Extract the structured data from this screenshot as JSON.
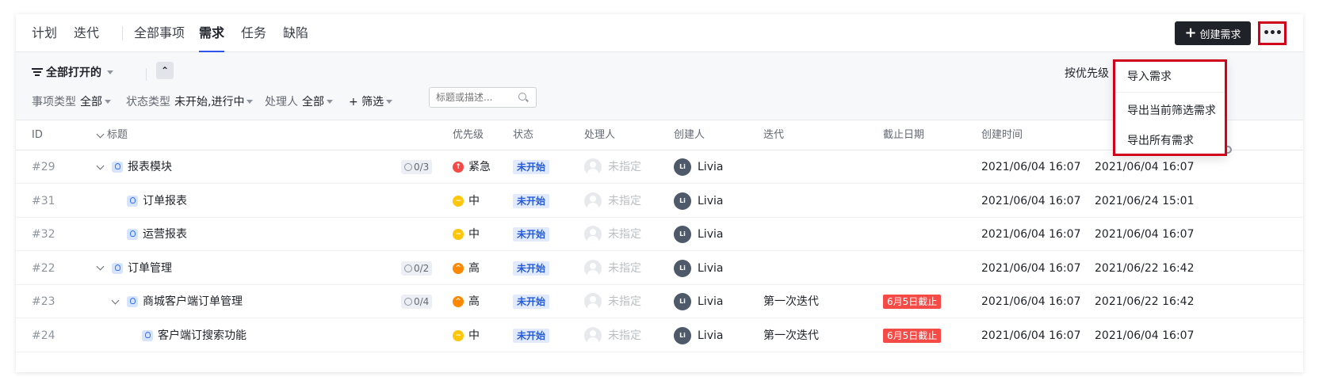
{
  "nav": {
    "items": [
      {
        "label": "计划"
      },
      {
        "label": "迭代"
      },
      {
        "label": "全部事项"
      },
      {
        "label": "需求"
      },
      {
        "label": "任务"
      },
      {
        "label": "缺陷"
      }
    ],
    "active": "需求",
    "create_button": "创建需求"
  },
  "filters": {
    "view": "全部打开的",
    "sort_label": "按优先级",
    "type": {
      "label": "事项类型",
      "value": "全部"
    },
    "status": {
      "label": "状态类型",
      "value": "未开始,进行中"
    },
    "assignee": {
      "label": "处理人",
      "value": "全部"
    },
    "more": "+ 筛选",
    "search_placeholder": "标题或描述..."
  },
  "table": {
    "headers": {
      "id": "ID",
      "title": "标题",
      "priority": "优先级",
      "status": "状态",
      "assignee": "处理人",
      "creator": "创建人",
      "iteration": "迭代",
      "due": "截止日期",
      "created": "创建时间"
    },
    "rows": [
      {
        "id": "#29",
        "level": 0,
        "expand": true,
        "title": "报表模块",
        "children_count": "0/3",
        "priority": "紧急",
        "priority_color": "#f54a45",
        "status": "未开始",
        "assignee": "未指定",
        "creator": "Livia",
        "iteration": "",
        "due": "",
        "created": "2021/06/04 16:07",
        "updated": "2021/06/04 16:07"
      },
      {
        "id": "#31",
        "level": 1,
        "expand": false,
        "title": "订单报表",
        "children_count": "",
        "priority": "中",
        "priority_color": "#ffc60a",
        "status": "未开始",
        "assignee": "未指定",
        "creator": "Livia",
        "iteration": "",
        "due": "",
        "created": "2021/06/04 16:07",
        "updated": "2021/06/24 15:01"
      },
      {
        "id": "#32",
        "level": 1,
        "expand": false,
        "title": "运营报表",
        "children_count": "",
        "priority": "中",
        "priority_color": "#ffc60a",
        "status": "未开始",
        "assignee": "未指定",
        "creator": "Livia",
        "iteration": "",
        "due": "",
        "created": "2021/06/04 16:07",
        "updated": "2021/06/04 16:07"
      },
      {
        "id": "#22",
        "level": 0,
        "expand": true,
        "title": "订单管理",
        "children_count": "0/2",
        "priority": "高",
        "priority_color": "#ff8800",
        "status": "未开始",
        "assignee": "未指定",
        "creator": "Livia",
        "iteration": "",
        "due": "",
        "created": "2021/06/04 16:07",
        "updated": "2021/06/22 16:42"
      },
      {
        "id": "#23",
        "level": 1,
        "expand": true,
        "title": "商城客户端订单管理",
        "children_count": "0/4",
        "priority": "高",
        "priority_color": "#ff8800",
        "status": "未开始",
        "assignee": "未指定",
        "creator": "Livia",
        "iteration": "第一次迭代",
        "due": "6月5日截止",
        "created": "2021/06/04 16:07",
        "updated": "2021/06/22 16:42"
      },
      {
        "id": "#24",
        "level": 2,
        "expand": false,
        "title": "客户端订搜索功能",
        "children_count": "",
        "priority": "中",
        "priority_color": "#ffc60a",
        "status": "未开始",
        "assignee": "未指定",
        "creator": "Livia",
        "iteration": "第一次迭代",
        "due": "6月5日截止",
        "created": "2021/06/04 16:07",
        "updated": "2021/06/04 16:07"
      }
    ]
  },
  "dropdown": {
    "items": [
      "导入需求",
      "导出当前筛选需求",
      "导出所有需求"
    ]
  },
  "colors": {
    "primary": "#1f2329",
    "accent": "#2f54eb",
    "highlight_border": "#d0021b",
    "status_bg": "#e1eaff",
    "due_bg": "#f54a45"
  }
}
